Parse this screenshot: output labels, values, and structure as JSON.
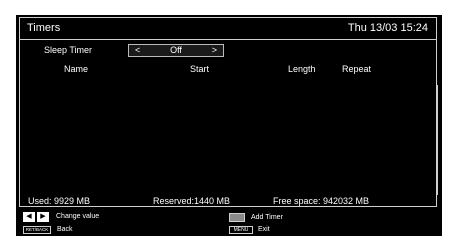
{
  "header": {
    "title": "Timers",
    "datetime": "Thu 13/03 15:24"
  },
  "sleep_timer": {
    "label": "Sleep Timer",
    "value": "Off",
    "left_arrow": "<",
    "right_arrow": ">"
  },
  "columns": {
    "name": "Name",
    "start": "Start",
    "length": "Length",
    "repeat": "Repeat"
  },
  "stats": {
    "used": "Used: 9929 MB",
    "reserved": "Reserved:1440 MB",
    "free": "Free space: 942032 MB"
  },
  "legend": {
    "left_key": "◀",
    "right_key": "▶",
    "change_value": "Change value",
    "back_key": "RET/BACK",
    "back": "Back",
    "add_timer": "Add Timer",
    "menu_key": "MENU",
    "exit": "Exit"
  },
  "colors": {
    "background": "#000000",
    "text": "#ffffff",
    "border": "#cfcfcf",
    "key_grey": "#8a8a8a"
  }
}
